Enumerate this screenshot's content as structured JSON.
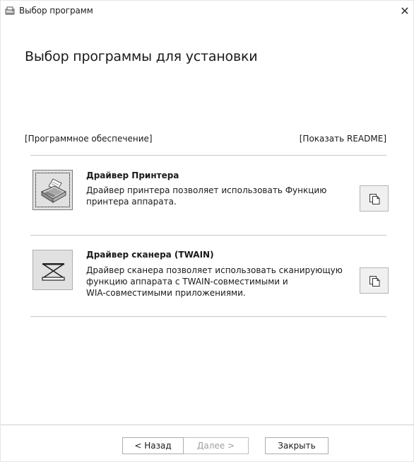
{
  "window": {
    "title": "Выбор программ",
    "close_glyph": "✕"
  },
  "heading": "Выбор программы для установки",
  "section": {
    "software_label": "[Программное обеспечение]",
    "readme_label": "[Показать README]"
  },
  "items": [
    {
      "title": "Драйвер Принтера",
      "description": "Драйвер принтера позволяет использовать Функцию\nпринтера аппарата.",
      "icon": "printer-icon",
      "readme_icon": "document-copy-icon"
    },
    {
      "title": "Драйвер сканера (TWAIN)",
      "description": "Драйвер сканера позволяет использовать сканирующую\nфункцию аппарата с TWAIN-совместимыми и\nWIA-совместимыми приложениями.",
      "icon": "scanner-icon",
      "readme_icon": "document-copy-icon"
    }
  ],
  "buttons": {
    "back": "< Назад",
    "next": "Далее >",
    "close": "Закрыть"
  }
}
